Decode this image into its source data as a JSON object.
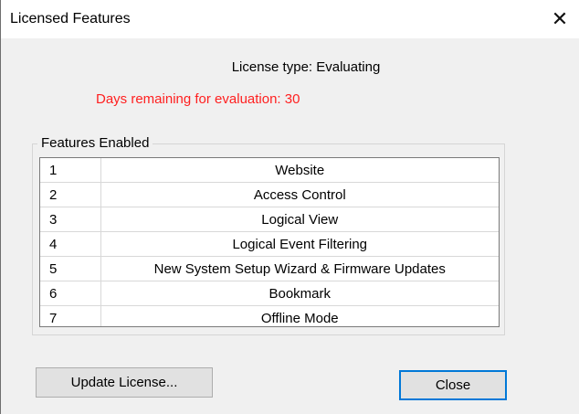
{
  "window": {
    "title": "Licensed Features",
    "close_glyph": "✕"
  },
  "license": {
    "type_text": "License type: Evaluating",
    "days_text": "Days remaining for evaluation: 30",
    "days_color": "#ff2020"
  },
  "features": {
    "group_label": "Features Enabled",
    "rows": [
      {
        "num": "1",
        "name": "Website"
      },
      {
        "num": "2",
        "name": "Access Control"
      },
      {
        "num": "3",
        "name": "Logical View"
      },
      {
        "num": "4",
        "name": "Logical Event Filtering"
      },
      {
        "num": "5",
        "name": "New System Setup Wizard & Firmware Updates"
      },
      {
        "num": "6",
        "name": "Bookmark"
      },
      {
        "num": "7",
        "name": "Offline Mode"
      }
    ]
  },
  "buttons": {
    "update_label": "Update License...",
    "close_label": "Close",
    "focus_color": "#0078d7"
  }
}
